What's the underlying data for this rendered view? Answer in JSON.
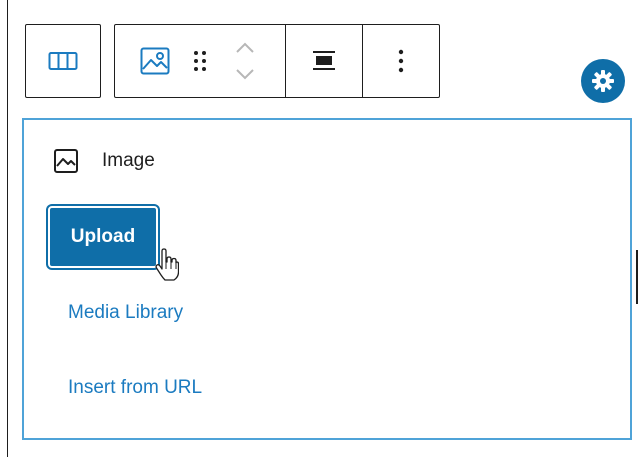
{
  "toolbar": {
    "icons": [
      "columns-icon",
      "image-icon",
      "drag-handle-icon",
      "move-up-down-icon",
      "align-icon",
      "more-options-icon"
    ]
  },
  "settings": {
    "icon": "gear-icon"
  },
  "placeholder": {
    "title": "Image",
    "upload_label": "Upload",
    "media_library_label": "Media Library",
    "insert_url_label": "Insert from URL"
  },
  "colors": {
    "accent": "#0f6ea8",
    "link": "#1b7bc0",
    "focus_border": "#4fa3d8",
    "text": "#1e1e1e"
  }
}
